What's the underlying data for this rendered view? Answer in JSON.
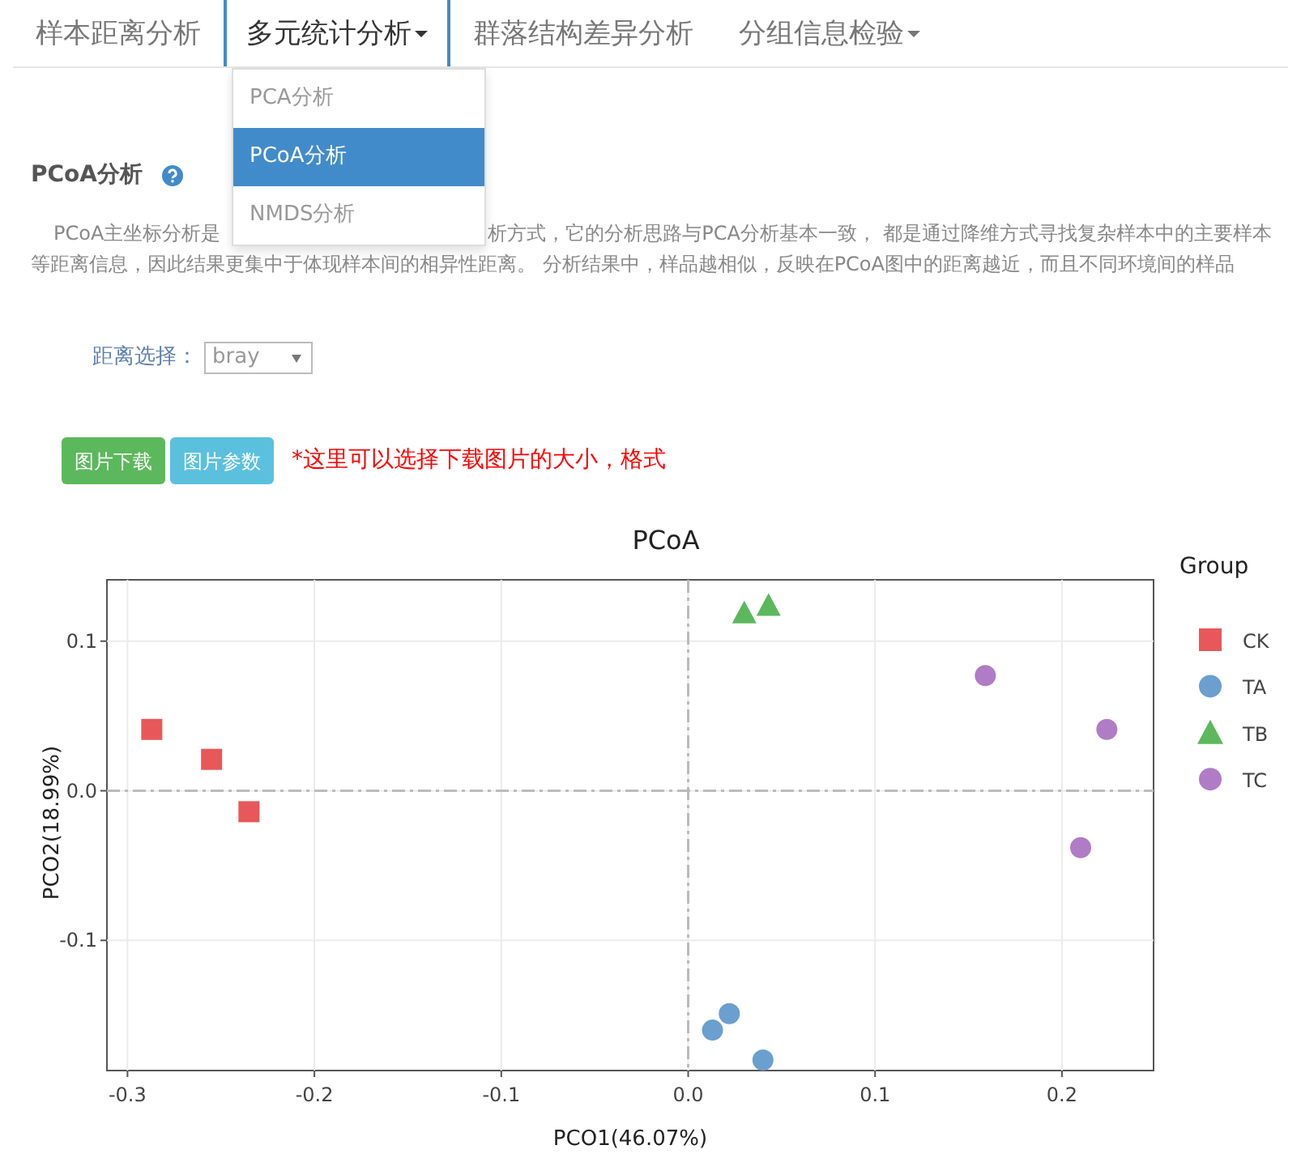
{
  "nav_tabs": [
    {
      "label": "样本距离分析",
      "selected": false,
      "dropdown": false
    },
    {
      "label": "多元统计分析",
      "selected": true,
      "dropdown": true
    },
    {
      "label": "群落结构差异分析",
      "selected": false,
      "dropdown": false
    },
    {
      "label": "分组信息检验",
      "selected": false,
      "dropdown": true
    }
  ],
  "dropdown_menu": [
    {
      "label": "PCA分析",
      "selected": false
    },
    {
      "label": "PCoA分析",
      "selected": true
    },
    {
      "label": "NMDS分析",
      "selected": false
    }
  ],
  "section": {
    "title": "PCoA分析",
    "description_lines": [
      [
        "PCoA主坐标分析是",
        "析方式，它的分析思路与PCA分析基本一致， 都是通过降维方式寻找复杂样本中的主要样本"
      ],
      [
        "等距离信息，因此结果更集中于体现样本间的相异性距离。 分析结果中，样品越相似，反映在PCoA图中的距离越近，而且不同环境间的样品"
      ]
    ]
  },
  "distance_select": {
    "label": "距离选择：",
    "value": "bray"
  },
  "buttons": [
    {
      "label": "图片下载",
      "kind": "success"
    },
    {
      "label": "图片参数",
      "kind": "info"
    }
  ],
  "note": "*这里可以选择下载图片的大小，格式",
  "chart": {
    "chart_data": {
      "type": "scatter",
      "title": "PCoA",
      "xlabel": "PCO1(46.07%)",
      "ylabel": "PCO2(18.99%)",
      "grid": true,
      "legend": {
        "title": "Group"
      },
      "xlim": [
        -0.311,
        0.249
      ],
      "ylim": [
        -0.187,
        0.141
      ],
      "xticks": [
        {
          "value": -0.3,
          "label": "-0.3"
        },
        {
          "value": -0.2,
          "label": "-0.2"
        },
        {
          "value": -0.1,
          "label": "-0.1"
        },
        {
          "value": 0,
          "label": "0.0"
        },
        {
          "value": 0.1,
          "label": "0.1"
        },
        {
          "value": 0.2,
          "label": "0.2"
        }
      ],
      "yticks": [
        {
          "value": -0.1,
          "label": "-0.1"
        },
        {
          "value": 0,
          "label": "0.0"
        },
        {
          "value": 0.1,
          "label": "0.1"
        }
      ],
      "series": [
        {
          "name": "CK",
          "color": "#e8575a",
          "marker": "square",
          "x": [
            -0.287,
            -0.255,
            -0.235
          ],
          "values": [
            0.041,
            0.021,
            -0.014
          ]
        },
        {
          "name": "TA",
          "color": "#6b9fcf",
          "marker": "circle",
          "x": [
            0.013,
            0.022,
            0.04
          ],
          "values": [
            -0.16,
            -0.149,
            -0.18
          ]
        },
        {
          "name": "TB",
          "color": "#5cb85c",
          "marker": "triangle",
          "x": [
            0.03,
            0.043
          ],
          "values": [
            0.119,
            0.124
          ]
        },
        {
          "name": "TC",
          "color": "#b07cc6",
          "marker": "circle",
          "x": [
            0.159,
            0.224,
            0.21
          ],
          "values": [
            0.077,
            0.041,
            -0.038
          ]
        }
      ]
    }
  }
}
